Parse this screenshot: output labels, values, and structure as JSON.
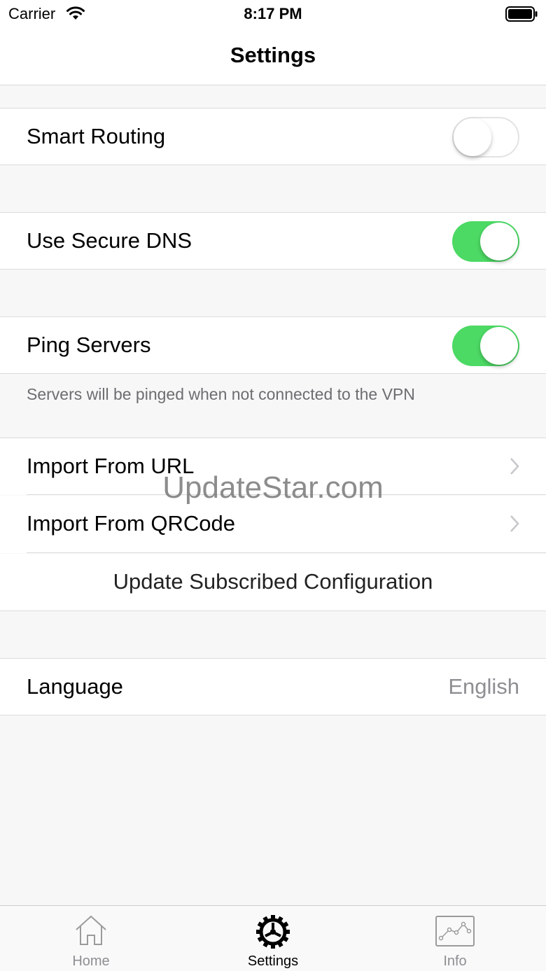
{
  "status_bar": {
    "carrier": "Carrier",
    "time": "8:17 PM"
  },
  "nav": {
    "title": "Settings"
  },
  "settings": {
    "smart_routing": {
      "label": "Smart Routing",
      "enabled": false
    },
    "secure_dns": {
      "label": "Use Secure DNS",
      "enabled": true
    },
    "ping_servers": {
      "label": "Ping Servers",
      "enabled": true,
      "footer": "Servers will be pinged when not connected to the VPN"
    },
    "import_url": {
      "label": "Import From URL"
    },
    "import_qrcode": {
      "label": "Import From QRCode"
    },
    "update_subscribed": {
      "label": "Update Subscribed Configuration"
    },
    "language": {
      "label": "Language",
      "value": "English"
    }
  },
  "watermark": "UpdateStar.com",
  "tabs": [
    {
      "label": "Home",
      "icon": "home-icon"
    },
    {
      "label": "Settings",
      "icon": "gear-icon",
      "active": true
    },
    {
      "label": "Info",
      "icon": "chart-icon"
    }
  ],
  "colors": {
    "toggle_on": "#4cd964",
    "secondary_text": "#8e8e93"
  }
}
